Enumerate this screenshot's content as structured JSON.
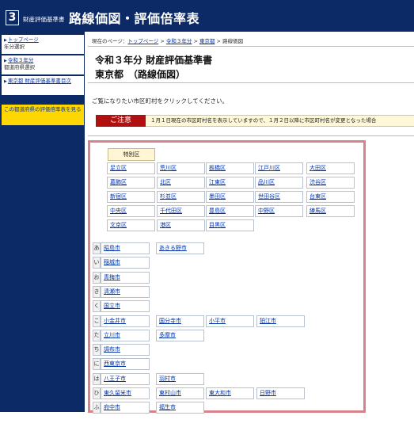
{
  "header": {
    "logo_num": "3",
    "logo_sub": "財産評価基準書",
    "title": "路線価図・評価倍率表"
  },
  "sidebar": {
    "items": [
      {
        "label": "トップページ",
        "sub": "年分選択"
      },
      {
        "label": "令和３年分",
        "sub": "都道府県選択"
      },
      {
        "label": "東京都 財産評価基準書目次",
        "sub": ""
      }
    ],
    "current": "この都道府県の評価倍率表を見る"
  },
  "breadcrumb": {
    "prefix": "現在のページ：",
    "items": [
      "トップページ",
      "令和３年分",
      "東京都"
    ],
    "current": "路線価図",
    "sep": ">"
  },
  "main": {
    "title1": "令和３年分 財産評価基準書",
    "title2": "東京都　（路線価図）",
    "instruction": "ご覧になりたい市区町村をクリックしてください。",
    "notice_label": "ご注意",
    "notice_text": "１月１日現在の市区町村名を表示していますので、１月２日以降に市区町村名が変更となった場合"
  },
  "wards": {
    "header": "特別区",
    "rows": [
      [
        "足立区",
        "荒川区",
        "板橋区",
        "江戸川区",
        "大田区"
      ],
      [
        "葛飾区",
        "北区",
        "江東区",
        "品川区",
        "渋谷区"
      ],
      [
        "新宿区",
        "杉並区",
        "墨田区",
        "世田谷区",
        "台東区"
      ],
      [
        "中央区",
        "千代田区",
        "豊島区",
        "中野区",
        "練馬区"
      ],
      [
        "文京区",
        "港区",
        "目黒区"
      ]
    ]
  },
  "cities": [
    {
      "kana": "あ",
      "items": [
        "昭島市",
        "あきる野市"
      ]
    },
    {
      "kana": "い",
      "items": [
        "稲城市"
      ]
    },
    {
      "kana": "お",
      "items": [
        "青梅市"
      ]
    },
    {
      "kana": "き",
      "items": [
        "清瀬市"
      ]
    },
    {
      "kana": "く",
      "items": [
        "国立市"
      ]
    },
    {
      "kana": "こ",
      "items": [
        "小金井市",
        "国分寺市",
        "小平市",
        "狛江市"
      ]
    },
    {
      "kana": "た",
      "items": [
        "立川市",
        "多摩市"
      ]
    },
    {
      "kana": "ち",
      "items": [
        "調布市"
      ]
    },
    {
      "kana": "に",
      "items": [
        "西東京市"
      ]
    },
    {
      "kana": "は",
      "items": [
        "八王子市",
        "羽村市"
      ]
    },
    {
      "kana": "ひ",
      "items": [
        "東久留米市",
        "東村山市",
        "東大和市",
        "日野市"
      ]
    },
    {
      "kana": "ふ",
      "items": [
        "府中市",
        "福生市"
      ]
    }
  ]
}
